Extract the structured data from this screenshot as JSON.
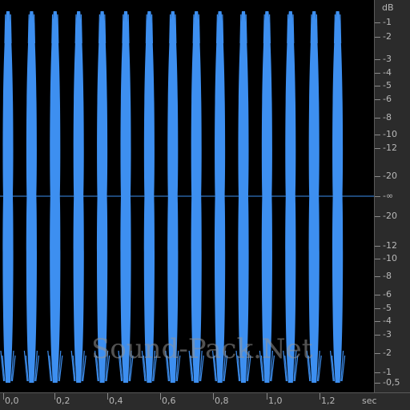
{
  "colors": {
    "waveform": "#3d8ff0",
    "background": "#000000",
    "panel": "#2b2b2b",
    "text": "#b8b8b8"
  },
  "waveform": {
    "burst_count": 15,
    "duration_sec": 1.5
  },
  "db_scale": {
    "unit": "dB",
    "labels": [
      "-1",
      "-2",
      "-3",
      "-4",
      "-5",
      "-6",
      "-8",
      "-10",
      "-12",
      "-20",
      "-∞",
      "-20",
      "-12",
      "-10",
      "-8",
      "-6",
      "-5",
      "-4",
      "-3",
      "-2",
      "-1",
      "-0,5"
    ]
  },
  "time_axis": {
    "unit": "sec",
    "labels": [
      "0,0",
      "0,2",
      "0,4",
      "0,6",
      "0,8",
      "1,0",
      "1,2"
    ]
  },
  "watermark": "Sound-Pack.Net"
}
